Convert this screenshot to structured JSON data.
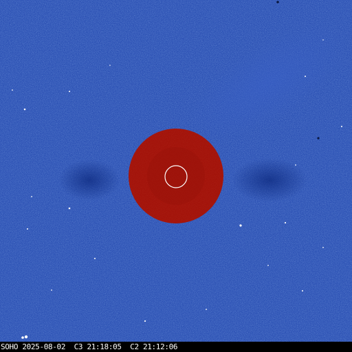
{
  "image": {
    "description_colors": {
      "sky": "#2a4fb3",
      "occulter": "#a3140b",
      "sun_outline": "#ffffff",
      "caption_text": "#ffffff",
      "caption_background": "#000000"
    },
    "caption": "SOHO 2025-08-02  C3 21:18:05  C2 21:12:06"
  }
}
